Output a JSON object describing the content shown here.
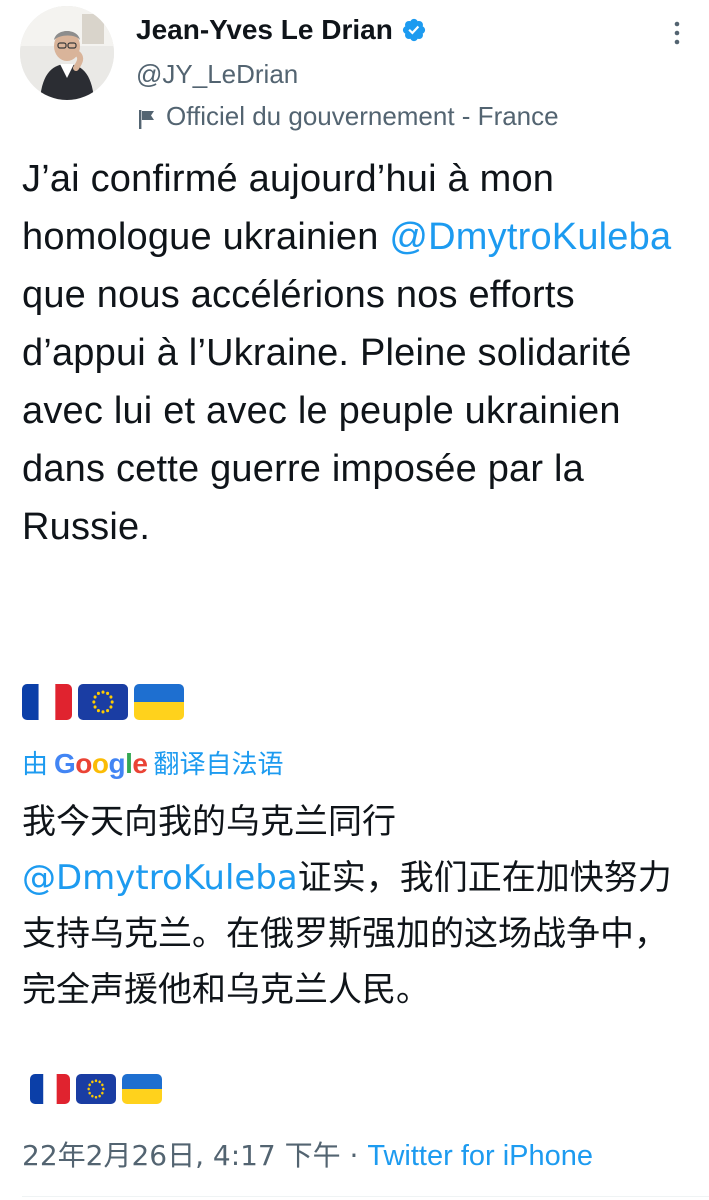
{
  "author": {
    "display_name": "Jean-Yves Le Drian",
    "handle": "@JY_LeDrian",
    "label": "Officiel du gouvernement - France"
  },
  "tweet": {
    "text_before_mention": "J’ai confirmé aujourd’hui à mon homologue ukrainien ",
    "mention": "@DmytroKuleba",
    "text_after_mention": " que nous accélérions nos efforts d’appui à l’Ukraine. Pleine solidarité avec lui et avec le peuple ukrainien dans cette guerre imposée par la Russie."
  },
  "emoji_flags": [
    "flag-france",
    "flag-eu",
    "flag-ukraine"
  ],
  "translation": {
    "prefix": "由",
    "provider": "Google",
    "suffix": "翻译自法语",
    "text_line1": "我今天向我的乌克兰同行",
    "mention": "@DmytroKuleba",
    "text_after_mention": "证实，我们正在加快努力支持乌克兰。在俄罗斯强加的这场战争中，完全声援他和乌克兰人民。"
  },
  "meta": {
    "timestamp": "22年2月26日, 4:17 下午",
    "separator": " · ",
    "source": "Twitter for iPhone"
  },
  "colors": {
    "link": "#1d9bf0",
    "secondary_text": "#536471",
    "primary_text": "#0f1419"
  }
}
